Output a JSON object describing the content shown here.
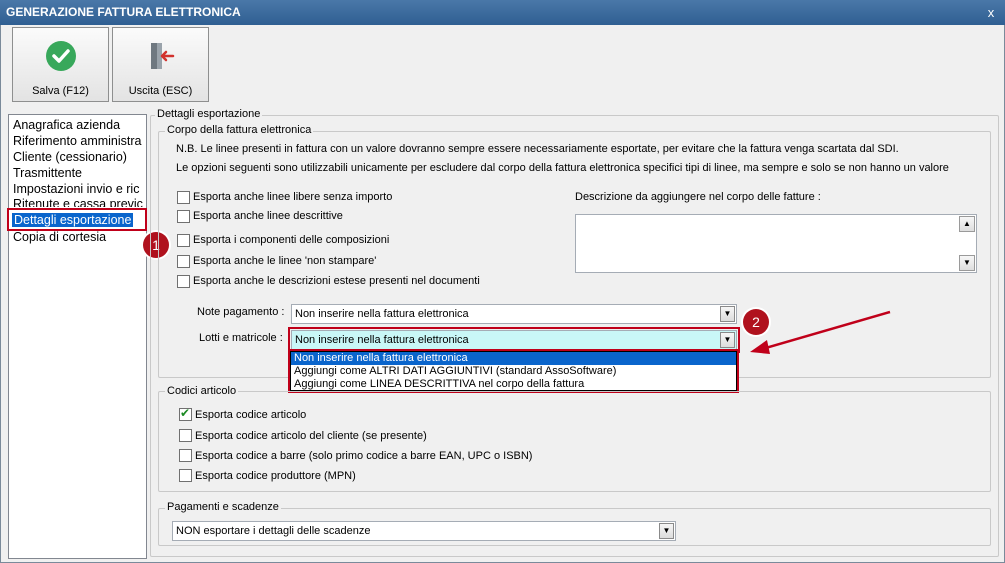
{
  "window": {
    "title": "GENERAZIONE FATTURA ELETTRONICA",
    "close_glyph": "x"
  },
  "toolbar": {
    "save_label": "Salva (F12)",
    "exit_label": "Uscita (ESC)"
  },
  "nav": {
    "items": [
      "Anagrafica azienda",
      "Riferimento amministra",
      "Cliente (cessionario)",
      "Trasmittente",
      "Impostazioni invio e ric",
      "Ritenute e cassa previc",
      "Dettagli esportazione",
      "Copia di cortesia"
    ],
    "selected": "Dettagli esportazione"
  },
  "main": {
    "section_title": "Dettagli esportazione",
    "corpo": {
      "title": "Corpo della fattura elettronica",
      "note1": "N.B. Le linee presenti in fattura con un valore dovranno sempre essere necessariamente esportate, per evitare che la fattura venga scartata dal SDI.",
      "note2": "Le opzioni seguenti sono utilizzabili unicamente per escludere dal corpo della fattura elettronica specifici tipi di linee, ma sempre e solo se non hanno un valore",
      "options": [
        {
          "label": "Esporta anche linee libere senza importo",
          "checked": false
        },
        {
          "label": "Esporta anche linee descrittive",
          "checked": false
        },
        {
          "label": "Esporta i componenti delle composizioni",
          "checked": false
        },
        {
          "label": "Esporta anche le linee 'non stampare'",
          "checked": false
        },
        {
          "label": "Esporta anche le descrizioni estese presenti nel documenti",
          "checked": false
        }
      ],
      "descr_label": "Descrizione da aggiungere nel corpo delle fatture :",
      "descr_value": "",
      "note_pagamento_label": "Note pagamento :",
      "note_pagamento_value": "Non inserire nella fattura elettronica",
      "lotti_label": "Lotti e matricole :",
      "lotti_value": "Non inserire nella fattura elettronica",
      "lotti_options": [
        "Non inserire nella fattura elettronica",
        "Aggiungi come ALTRI DATI AGGIUNTIVI (standard AssoSoftware)",
        "Aggiungi come LINEA DESCRITTIVA nel corpo della fattura"
      ]
    },
    "codici": {
      "title": "Codici articolo",
      "options": [
        {
          "label": "Esporta codice articolo",
          "checked": true
        },
        {
          "label": "Esporta codice articolo del cliente (se presente)",
          "checked": false
        },
        {
          "label": "Esporta codice a barre (solo primo codice a barre EAN, UPC o ISBN)",
          "checked": false
        },
        {
          "label": "Esporta codice produttore (MPN)",
          "checked": false
        }
      ]
    },
    "pagamenti": {
      "title": "Pagamenti e scadenze",
      "value": "NON esportare i dettagli delle scadenze"
    }
  },
  "annotations": {
    "badge1": "1",
    "badge2": "2"
  },
  "colors": {
    "accent_selection": "#0a65cc",
    "annotation_red": "#c0001a",
    "save_icon": "#38a85b",
    "exit_icon_arrow": "#d2322d"
  }
}
